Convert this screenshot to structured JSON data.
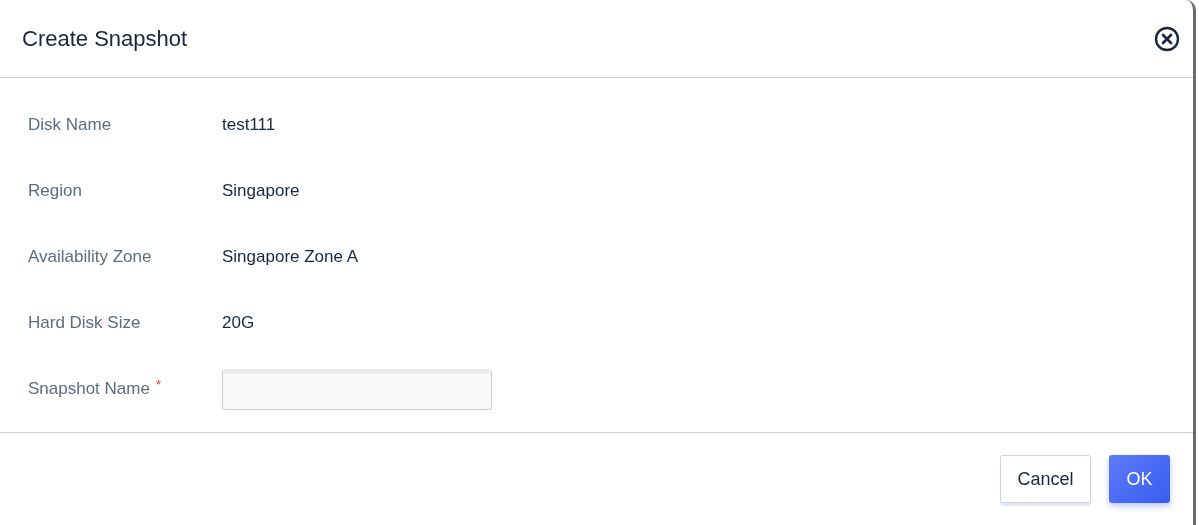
{
  "dialog": {
    "title": "Create Snapshot"
  },
  "fields": [
    {
      "kind": "text",
      "label": "Disk Name",
      "value": "test111"
    },
    {
      "kind": "text",
      "label": "Region",
      "value": "Singapore"
    },
    {
      "kind": "text",
      "label": "Availability Zone",
      "value": "Singapore Zone A"
    },
    {
      "kind": "text",
      "label": "Hard Disk Size",
      "value": "20G"
    },
    {
      "kind": "input",
      "label": "Snapshot Name",
      "required_mark": "*"
    }
  ],
  "buttons": [
    {
      "label": "Cancel",
      "kind": "secondary"
    },
    {
      "label": "OK",
      "kind": "primary"
    }
  ]
}
